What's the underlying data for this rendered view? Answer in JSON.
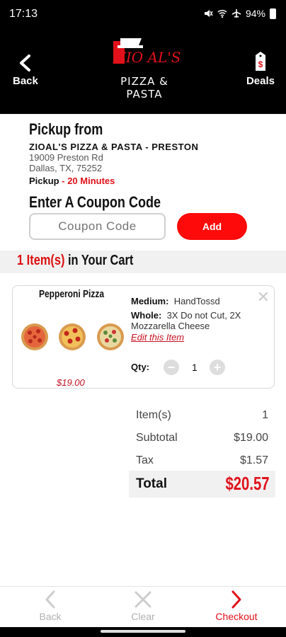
{
  "status_bar": {
    "time": "17:13",
    "battery": "94%"
  },
  "header": {
    "back_label": "Back",
    "deals_label": "Deals",
    "logo_top": "ZIO AL'S",
    "logo_sub": "PIZZA & PASTA"
  },
  "pickup": {
    "title": "Pickup from",
    "store": "ZIOAL'S PIZZA & PASTA - PRESTON",
    "address_line1": "19009 Preston Rd",
    "address_line2": "Dallas, TX, 75252",
    "type_label": "Pickup",
    "separator": " - ",
    "wait": "20 Minutes"
  },
  "coupon": {
    "title": "Enter A Coupon Code",
    "placeholder": "Coupon Code",
    "add_label": "Add"
  },
  "cart": {
    "count": "1 Item(s)",
    "suffix": " in Your Cart"
  },
  "item": {
    "name": "Pepperoni Pizza",
    "price": "$19.00",
    "size_label": "Medium:",
    "size_value": "HandTossd",
    "whole_label": "Whole:",
    "whole_value": "3X  Do not Cut, 2X Mozzarella Cheese",
    "edit_label": "Edit this Item",
    "qty_label": "Qty:",
    "qty_value": "1"
  },
  "totals": {
    "items_label": "Item(s)",
    "items_value": "1",
    "subtotal_label": "Subtotal",
    "subtotal_value": "$19.00",
    "tax_label": "Tax",
    "tax_value": "$1.57",
    "total_label": "Total",
    "total_value": "$20.57"
  },
  "bottom_nav": {
    "back_label": "Back",
    "clear_label": "Clear",
    "checkout_label": "Checkout"
  },
  "colors": {
    "accent": "#e0111a",
    "disabled": "#cccccc"
  }
}
